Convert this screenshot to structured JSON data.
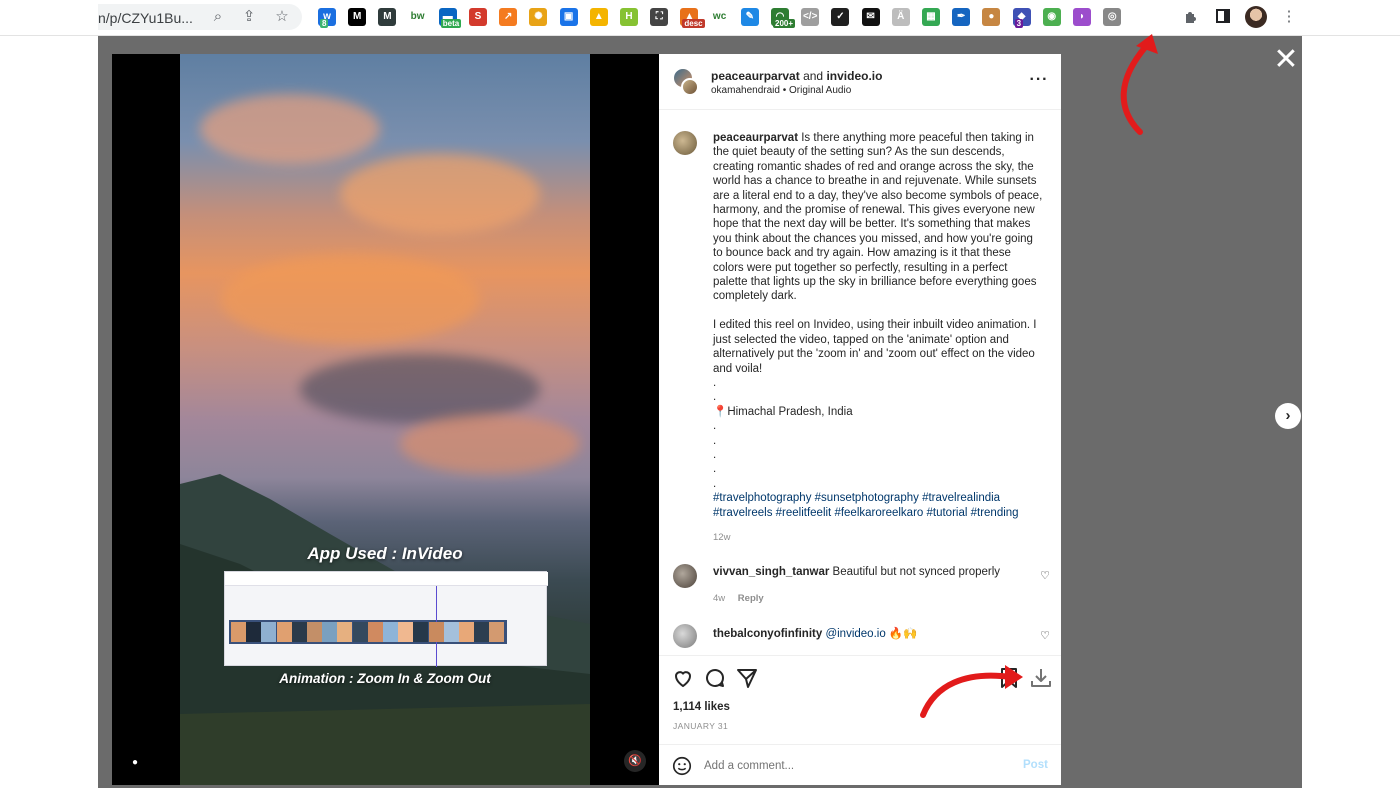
{
  "browser": {
    "url": "n/p/CZYu1Bu...",
    "extensions": [
      {
        "name": "ext-wordtune",
        "label": "w",
        "badge": "8",
        "color": "#1b6fe0",
        "badge_color": "#3cb371"
      },
      {
        "name": "ext-medium",
        "label": "M",
        "badge": "",
        "color": "#000000",
        "badge_color": ""
      },
      {
        "name": "ext-momentum",
        "label": "M",
        "badge": "",
        "color": "#2f3b3b",
        "badge_color": ""
      },
      {
        "name": "ext-bw",
        "label": "bw",
        "badge": "",
        "color": "#ffffff",
        "badge_color": ""
      },
      {
        "name": "ext-beta",
        "label": "▬",
        "badge": "beta",
        "color": "#0a66c2",
        "badge_color": "#2fa84f"
      },
      {
        "name": "ext-red-s",
        "label": "S",
        "badge": "",
        "color": "#d33a2c",
        "badge_color": ""
      },
      {
        "name": "ext-analytics",
        "label": "↗",
        "badge": "",
        "color": "#f47b20",
        "badge_color": ""
      },
      {
        "name": "ext-gear",
        "label": "✺",
        "badge": "",
        "color": "#e8a316",
        "badge_color": ""
      },
      {
        "name": "ext-blue-box",
        "label": "▣",
        "badge": "",
        "color": "#1a73e8",
        "badge_color": ""
      },
      {
        "name": "ext-drive",
        "label": "▲",
        "badge": "",
        "color": "#f4b400",
        "badge_color": ""
      },
      {
        "name": "ext-h",
        "label": "H",
        "badge": "",
        "color": "#86c232",
        "badge_color": ""
      },
      {
        "name": "ext-screenshot",
        "label": "⛶",
        "badge": "",
        "color": "#444444",
        "badge_color": ""
      },
      {
        "name": "ext-desc",
        "label": "▲",
        "badge": "desc",
        "color": "#e8711a",
        "badge_color": "#c0392b"
      },
      {
        "name": "ext-wc",
        "label": "wc",
        "badge": "",
        "color": "#ffffff",
        "badge_color": ""
      },
      {
        "name": "ext-pen",
        "label": "✎",
        "badge": "",
        "color": "#1e88e5",
        "badge_color": ""
      },
      {
        "name": "ext-200",
        "label": "◠",
        "badge": "200+",
        "color": "#2e7d32",
        "badge_color": "#2e7d32"
      },
      {
        "name": "ext-code",
        "label": "</>",
        "badge": "",
        "color": "#9e9e9e",
        "badge_color": ""
      },
      {
        "name": "ext-notepad",
        "label": "✓",
        "badge": "",
        "color": "#1f1f1f",
        "badge_color": ""
      },
      {
        "name": "ext-mail",
        "label": "✉",
        "badge": "",
        "color": "#111111",
        "badge_color": ""
      },
      {
        "name": "ext-grey",
        "label": "Ä",
        "badge": "",
        "color": "#bdbdbd",
        "badge_color": ""
      },
      {
        "name": "ext-sheet",
        "label": "▦",
        "badge": "",
        "color": "#34a853",
        "badge_color": ""
      },
      {
        "name": "ext-dropper",
        "label": "✒",
        "badge": "",
        "color": "#1565c0",
        "badge_color": ""
      },
      {
        "name": "ext-cookie",
        "label": "●",
        "badge": "",
        "color": "#c68642",
        "badge_color": ""
      },
      {
        "name": "ext-cube",
        "label": "◆",
        "badge": "3",
        "color": "#3f51b5",
        "badge_color": "#6a1b9a"
      },
      {
        "name": "ext-timer",
        "label": "◉",
        "badge": "",
        "color": "#4caf50",
        "badge_color": ""
      },
      {
        "name": "ext-purple",
        "label": "◗",
        "badge": "",
        "color": "#9c4dcc",
        "badge_color": ""
      },
      {
        "name": "ext-instagram-download",
        "label": "◎",
        "badge": "",
        "color": "#888888",
        "badge_color": ""
      }
    ]
  },
  "media": {
    "app_used": "App Used : InVideo",
    "animation": "Animation : Zoom In & Zoom Out"
  },
  "post": {
    "author1": "peaceaurparvat",
    "and": "and",
    "author2": "invideo.io",
    "subline": "okamahendraid • Original Audio",
    "caption_user": "peaceaurparvat",
    "caption_lines": [
      "Is there anything more peaceful then taking in",
      "the quiet beauty of the setting sun? As the sun descends,",
      "creating romantic shades of red and orange across the sky, the",
      "world has a chance to breathe in and rejuvenate. While sunsets",
      "are a literal end to a day, they've also become symbols of peace,",
      "harmony, and the promise of renewal. This gives everyone new",
      "hope that the next day will be better. It's something that makes",
      "you think about the chances you missed, and how you're going",
      "to bounce back and try again. How amazing is it that these",
      "colors were put together so perfectly, resulting in a perfect",
      "palette that lights up the sky in brilliance before everything goes",
      "completely dark.",
      "",
      "I edited this reel on Invideo, using their inbuilt video animation. I",
      "just selected the video, tapped on the 'animate' option and",
      "alternatively put the 'zoom in' and 'zoom out' effect on the video",
      "and voila!",
      ".",
      ".",
      "📍Himachal Pradesh, India",
      ".",
      ".",
      ".",
      ".",
      "."
    ],
    "hashtags_line1": "#travelphotography #sunsetphotography #travelrealindia",
    "hashtags_line2": "#travelreels #reelitfeelit #feelkaroreelkaro #tutorial #trending",
    "age": "12w",
    "comments": [
      {
        "user": "vivvan_singh_tanwar",
        "text": "Beautiful but not synced properly",
        "mention": "",
        "age": "4w",
        "reply": "Reply"
      },
      {
        "user": "thebalconyofinfinity",
        "text": "🔥🙌",
        "mention": "@invideo.io",
        "age": "",
        "reply": ""
      }
    ],
    "likes": "1,114 likes",
    "date": "JANUARY 31",
    "comment_placeholder": "Add a comment...",
    "post_label": "Post"
  },
  "colors": {
    "overlay": "#6b6b6b",
    "link": "#00376b",
    "arrow": "#e21b1b",
    "post_disabled": "#b2dffc"
  }
}
